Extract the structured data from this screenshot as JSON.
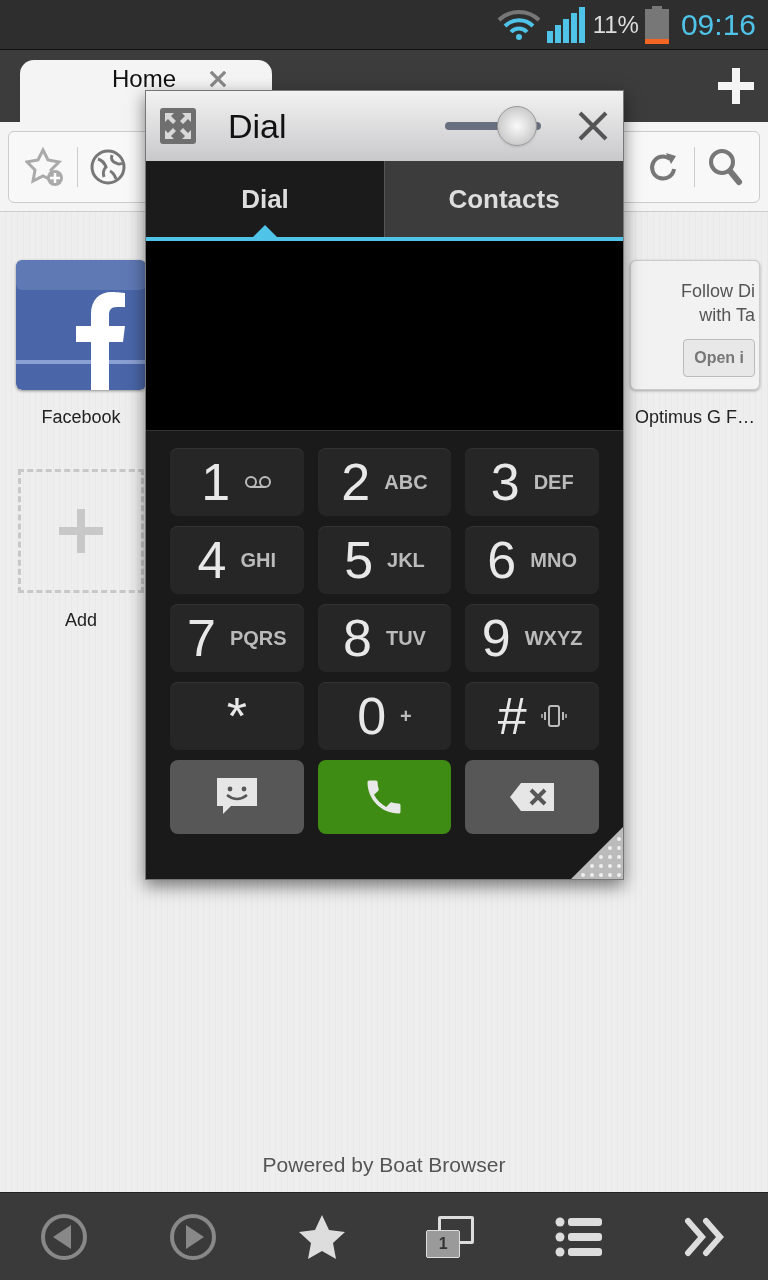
{
  "status_bar": {
    "battery": "11%",
    "time": "09:16"
  },
  "browser": {
    "tabs": [
      {
        "label": "Home",
        "selected": true
      }
    ]
  },
  "speed_dial": [
    {
      "kind": "facebook",
      "label": "Facebook"
    },
    {
      "kind": "promo",
      "label": "Optimus G F…",
      "lines": [
        "Follow Di",
        "with Ta"
      ],
      "button": "Open i"
    },
    {
      "kind": "add",
      "label": "Add"
    }
  ],
  "footer": "Powered by Boat Browser",
  "dial_window": {
    "title": "Dial",
    "slider": {
      "level": 0.75
    },
    "tabs": [
      {
        "label": "Dial",
        "selected": true
      },
      {
        "label": "Contacts",
        "selected": false
      }
    ],
    "keys": [
      {
        "kind": "voicemail",
        "digit": "1"
      },
      {
        "kind": "digit",
        "digit": "2",
        "letters": "ABC"
      },
      {
        "kind": "digit",
        "digit": "3",
        "letters": "DEF"
      },
      {
        "kind": "digit",
        "digit": "4",
        "letters": "GHI"
      },
      {
        "kind": "digit",
        "digit": "5",
        "letters": "JKL"
      },
      {
        "kind": "digit",
        "digit": "6",
        "letters": "MNO"
      },
      {
        "kind": "digit",
        "digit": "7",
        "letters": "PQRS"
      },
      {
        "kind": "digit",
        "digit": "8",
        "letters": "TUV"
      },
      {
        "kind": "digit",
        "digit": "9",
        "letters": "WXYZ"
      },
      {
        "kind": "digit",
        "digit": "*"
      },
      {
        "kind": "digit",
        "digit": "0",
        "letters": "+"
      },
      {
        "kind": "vibrate",
        "digit": "#"
      },
      {
        "kind": "message"
      },
      {
        "kind": "call"
      },
      {
        "kind": "delete"
      }
    ]
  },
  "bottom_bar": {
    "tab_count": "1"
  }
}
